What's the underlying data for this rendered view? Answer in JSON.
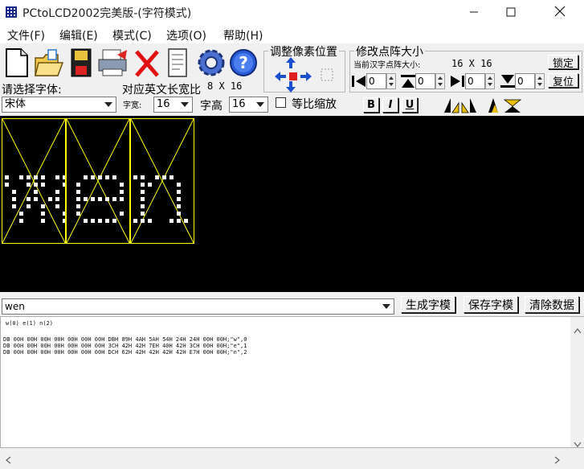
{
  "window": {
    "title": "PCtoLCD2002完美版-(字符模式)"
  },
  "menu": {
    "items": [
      "文件(F)",
      "编辑(E)",
      "模式(C)",
      "选项(O)",
      "帮助(H)"
    ]
  },
  "toolbar": {
    "icons": [
      "new-file-icon",
      "open-folder-icon",
      "save-disk-icon",
      "printer-icon",
      "delete-x-icon",
      "notepad-icon",
      "gear-icon",
      "help-icon"
    ]
  },
  "font_panel": {
    "select_font_label": "请选择字体:",
    "font_value": "宋体",
    "ratio_label": "对应英文长宽比",
    "ratio_value": "8 X 16",
    "width_label": "字宽:",
    "width_value": "16",
    "height_label": "字高",
    "height_value": "16",
    "proportional_label": "等比缩放",
    "bold_label": "B",
    "italic_label": "I",
    "underline_label": "U"
  },
  "pixel_adjust": {
    "title": "调整像素位置"
  },
  "matrix_size": {
    "title": "修改点阵大小",
    "current_label": "当前汉字点阵大小:",
    "current_value": "16 X 16",
    "lock_label": "锁定",
    "reset_label": "复位",
    "spin_values": [
      "0",
      "0",
      "0",
      "0"
    ]
  },
  "input": {
    "text": "wen",
    "generate_label": "生成字模",
    "save_label": "保存字模",
    "clear_label": "清除数据"
  },
  "output": {
    "summary": "w(0) e(1) n(2)",
    "lines": [
      "DB 00H 00H 00H 00H 00H 00H 00H DBH 89H 4AH 5AH 54H 24H 24H 00H 00H;\"w\",0",
      "DB 00H 00H 00H 00H 00H 00H 00H 3CH 42H 42H 7EH 40H 42H 3CH 00H 00H;\"e\",1",
      "DB 00H 00H 00H 00H 00H 00H 00H DCH 62H 42H 42H 42H 42H E7H 00H 00H;\"n\",2"
    ]
  },
  "canvas": {
    "glyph_pattern": [
      [
        "101111011",
        "100111001",
        "010010010",
        "010110110",
        "010101010",
        "001001001",
        "001001001"
      ],
      [
        "001111100",
        "010000010",
        "010000010",
        "011111110",
        "010000000",
        "010000010",
        "001111100"
      ],
      [
        "110111000",
        "011000100",
        "010000100",
        "010000100",
        "010000100",
        "010000100",
        "111001110"
      ]
    ]
  }
}
